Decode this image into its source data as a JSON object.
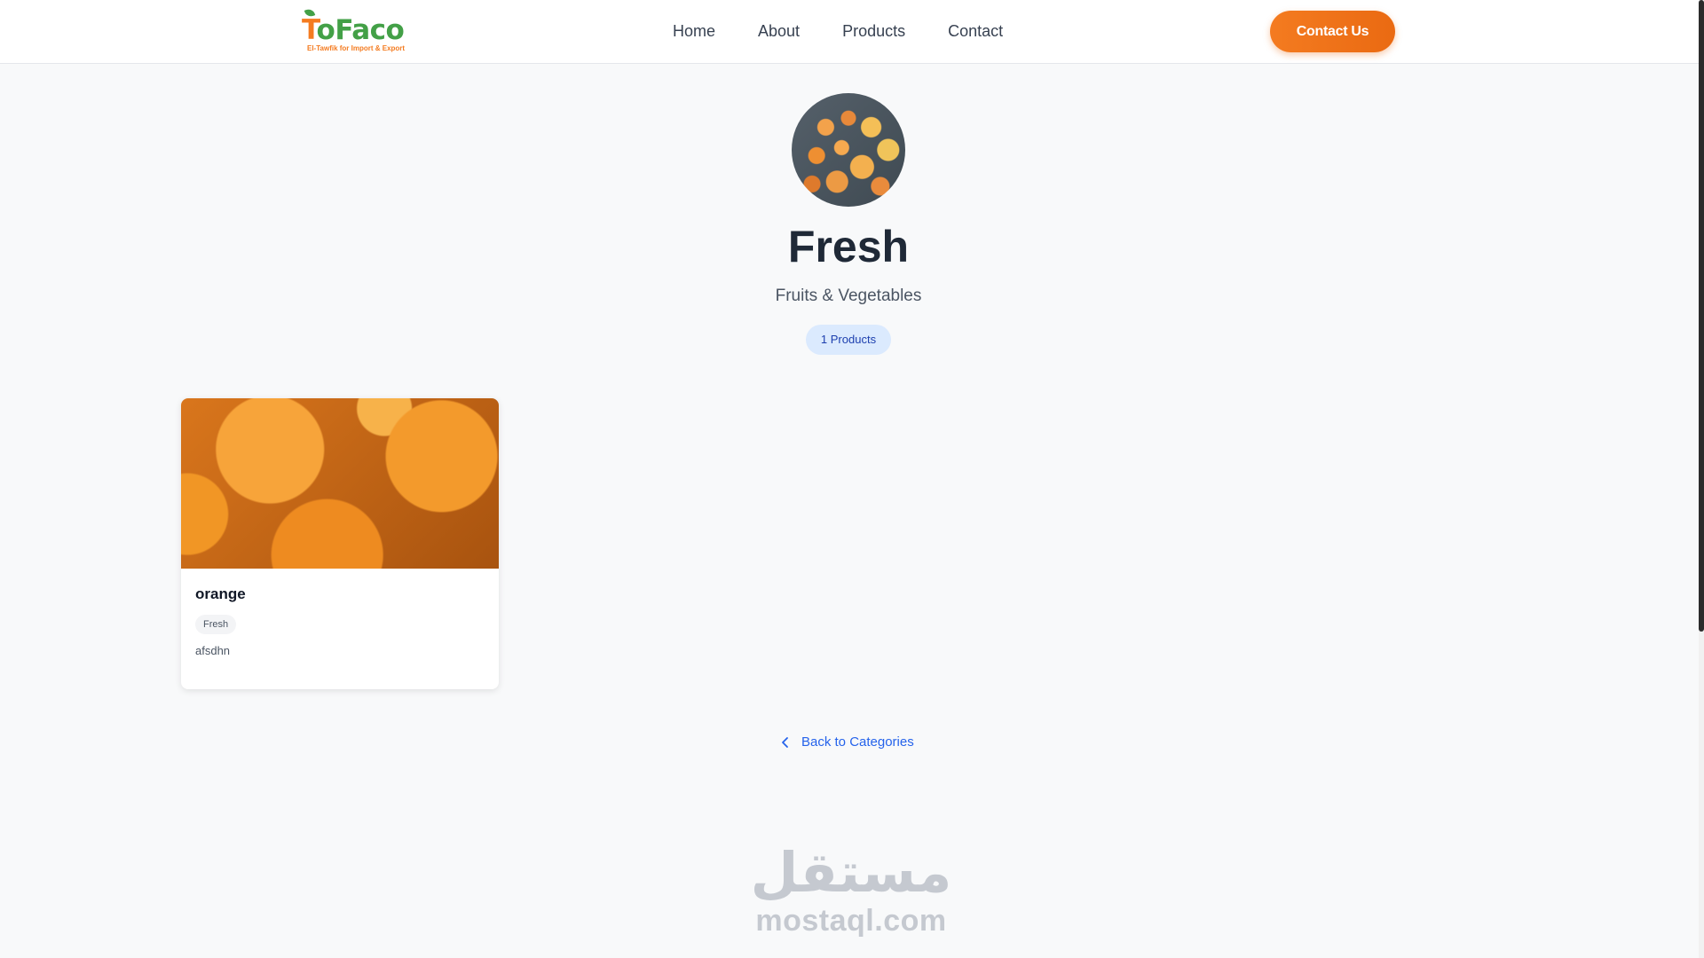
{
  "header": {
    "logo": {
      "text_accent": "T",
      "text_rest": "oFaco",
      "tagline": "El-Tawfik for Import & Export"
    },
    "nav": [
      {
        "label": "Home"
      },
      {
        "label": "About"
      },
      {
        "label": "Products"
      },
      {
        "label": "Contact"
      }
    ],
    "contact_button": "Contact Us"
  },
  "category": {
    "image_icon": "fruits-photo",
    "title": "Fresh",
    "subtitle": "Fruits & Vegetables",
    "count_badge": "1 Products"
  },
  "products": [
    {
      "name": "orange",
      "tag": "Fresh",
      "description": "afsdhn",
      "image_icon": "oranges-photo"
    }
  ],
  "back_link": {
    "label": "Back to Categories",
    "icon": "chevron-left-icon"
  },
  "watermark": {
    "arabic": "مستقل",
    "latin": "mostaql.com"
  },
  "colors": {
    "brand_orange": "#f47b20",
    "brand_green": "#43a047",
    "link_blue": "#2563eb",
    "badge_bg": "#dbeafe",
    "page_bg": "#f8f9fa"
  }
}
